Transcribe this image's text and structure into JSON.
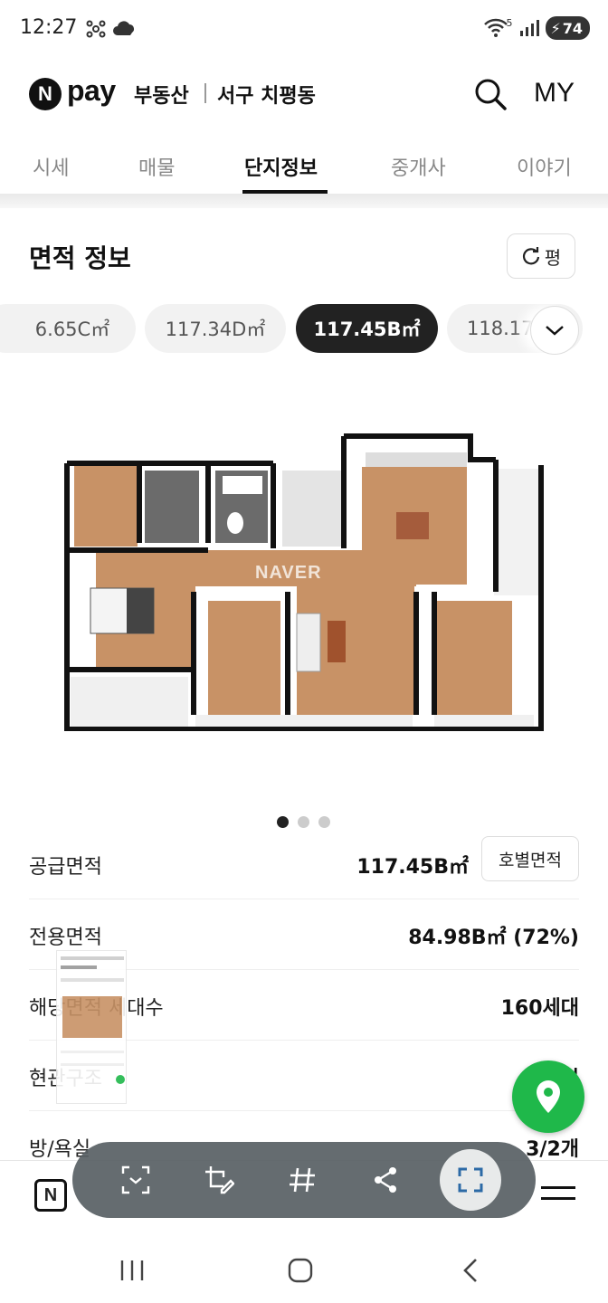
{
  "status_bar": {
    "time": "12:27",
    "battery": "74",
    "signal_label": "5"
  },
  "header": {
    "logo_n": "N",
    "logo_pay": "pay",
    "logo_estate": "부동산",
    "location": "서구 치평동",
    "my_label": "MY"
  },
  "tabs": [
    {
      "label": "시세",
      "active": false
    },
    {
      "label": "매물",
      "active": false
    },
    {
      "label": "단지정보",
      "active": true
    },
    {
      "label": "중개사",
      "active": false
    },
    {
      "label": "이야기",
      "active": false
    }
  ],
  "area_section": {
    "title": "면적 정보",
    "unit_toggle_label": "평",
    "chips": [
      {
        "label": "6.65C㎡",
        "active": false
      },
      {
        "label": "117.34D㎡",
        "active": false
      },
      {
        "label": "117.45B㎡",
        "active": true
      },
      {
        "label": "118.17",
        "active": false
      }
    ],
    "floorplan_watermark": "NAVER",
    "carousel": {
      "count": 3,
      "active_index": 0
    }
  },
  "info_rows": {
    "supply_area": {
      "label": "공급면적",
      "value": "117.45B㎡",
      "button": "호별면적"
    },
    "exclusive_area": {
      "label": "전용면적",
      "value": "84.98B㎡ (72%)"
    },
    "households": {
      "label": "해당면적 세대수",
      "value": "160세대"
    },
    "entrance": {
      "label": "현관구조",
      "value": "계단식"
    },
    "rooms": {
      "label": "방/욕실",
      "value": "3/2개"
    }
  },
  "bottom_nav": {
    "n_label": "N"
  },
  "icons": {
    "search": "search-icon",
    "refresh": "refresh-icon",
    "expand": "chevron-down-icon",
    "map": "map-pin-icon",
    "menu": "hamburger-icon"
  },
  "colors": {
    "accent_green": "#1fb84a",
    "chip_active": "#222222",
    "toolbar": "#586064"
  }
}
